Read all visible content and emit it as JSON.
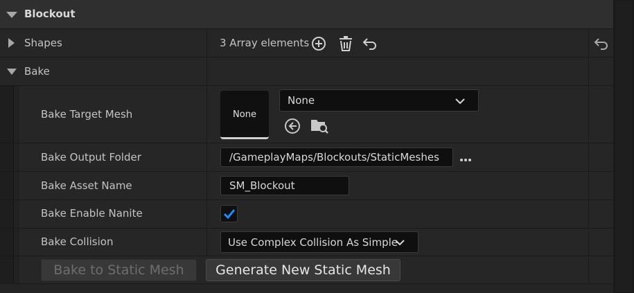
{
  "category": {
    "title": "Blockout"
  },
  "shapes": {
    "label": "Shapes",
    "value": "3 Array elements"
  },
  "bake": {
    "label": "Bake"
  },
  "bake_target_mesh": {
    "label": "Bake Target Mesh",
    "thumbnail_text": "None",
    "combo_value": "None"
  },
  "bake_output_folder": {
    "label": "Bake Output Folder",
    "value": "/GameplayMaps/Blockouts/StaticMeshes"
  },
  "bake_asset_name": {
    "label": "Bake Asset Name",
    "value": "SM_Blockout"
  },
  "bake_enable_nanite": {
    "label": "Bake Enable Nanite",
    "checked": true
  },
  "bake_collision": {
    "label": "Bake Collision",
    "value": "Use Complex Collision As Simple"
  },
  "buttons": {
    "bake_to_static_mesh": "Bake to Static Mesh",
    "generate_new_static_mesh": "Generate New Static Mesh"
  },
  "colors": {
    "accent": "#1a8cff",
    "panel": "#242424",
    "field": "#0f0f0f"
  }
}
